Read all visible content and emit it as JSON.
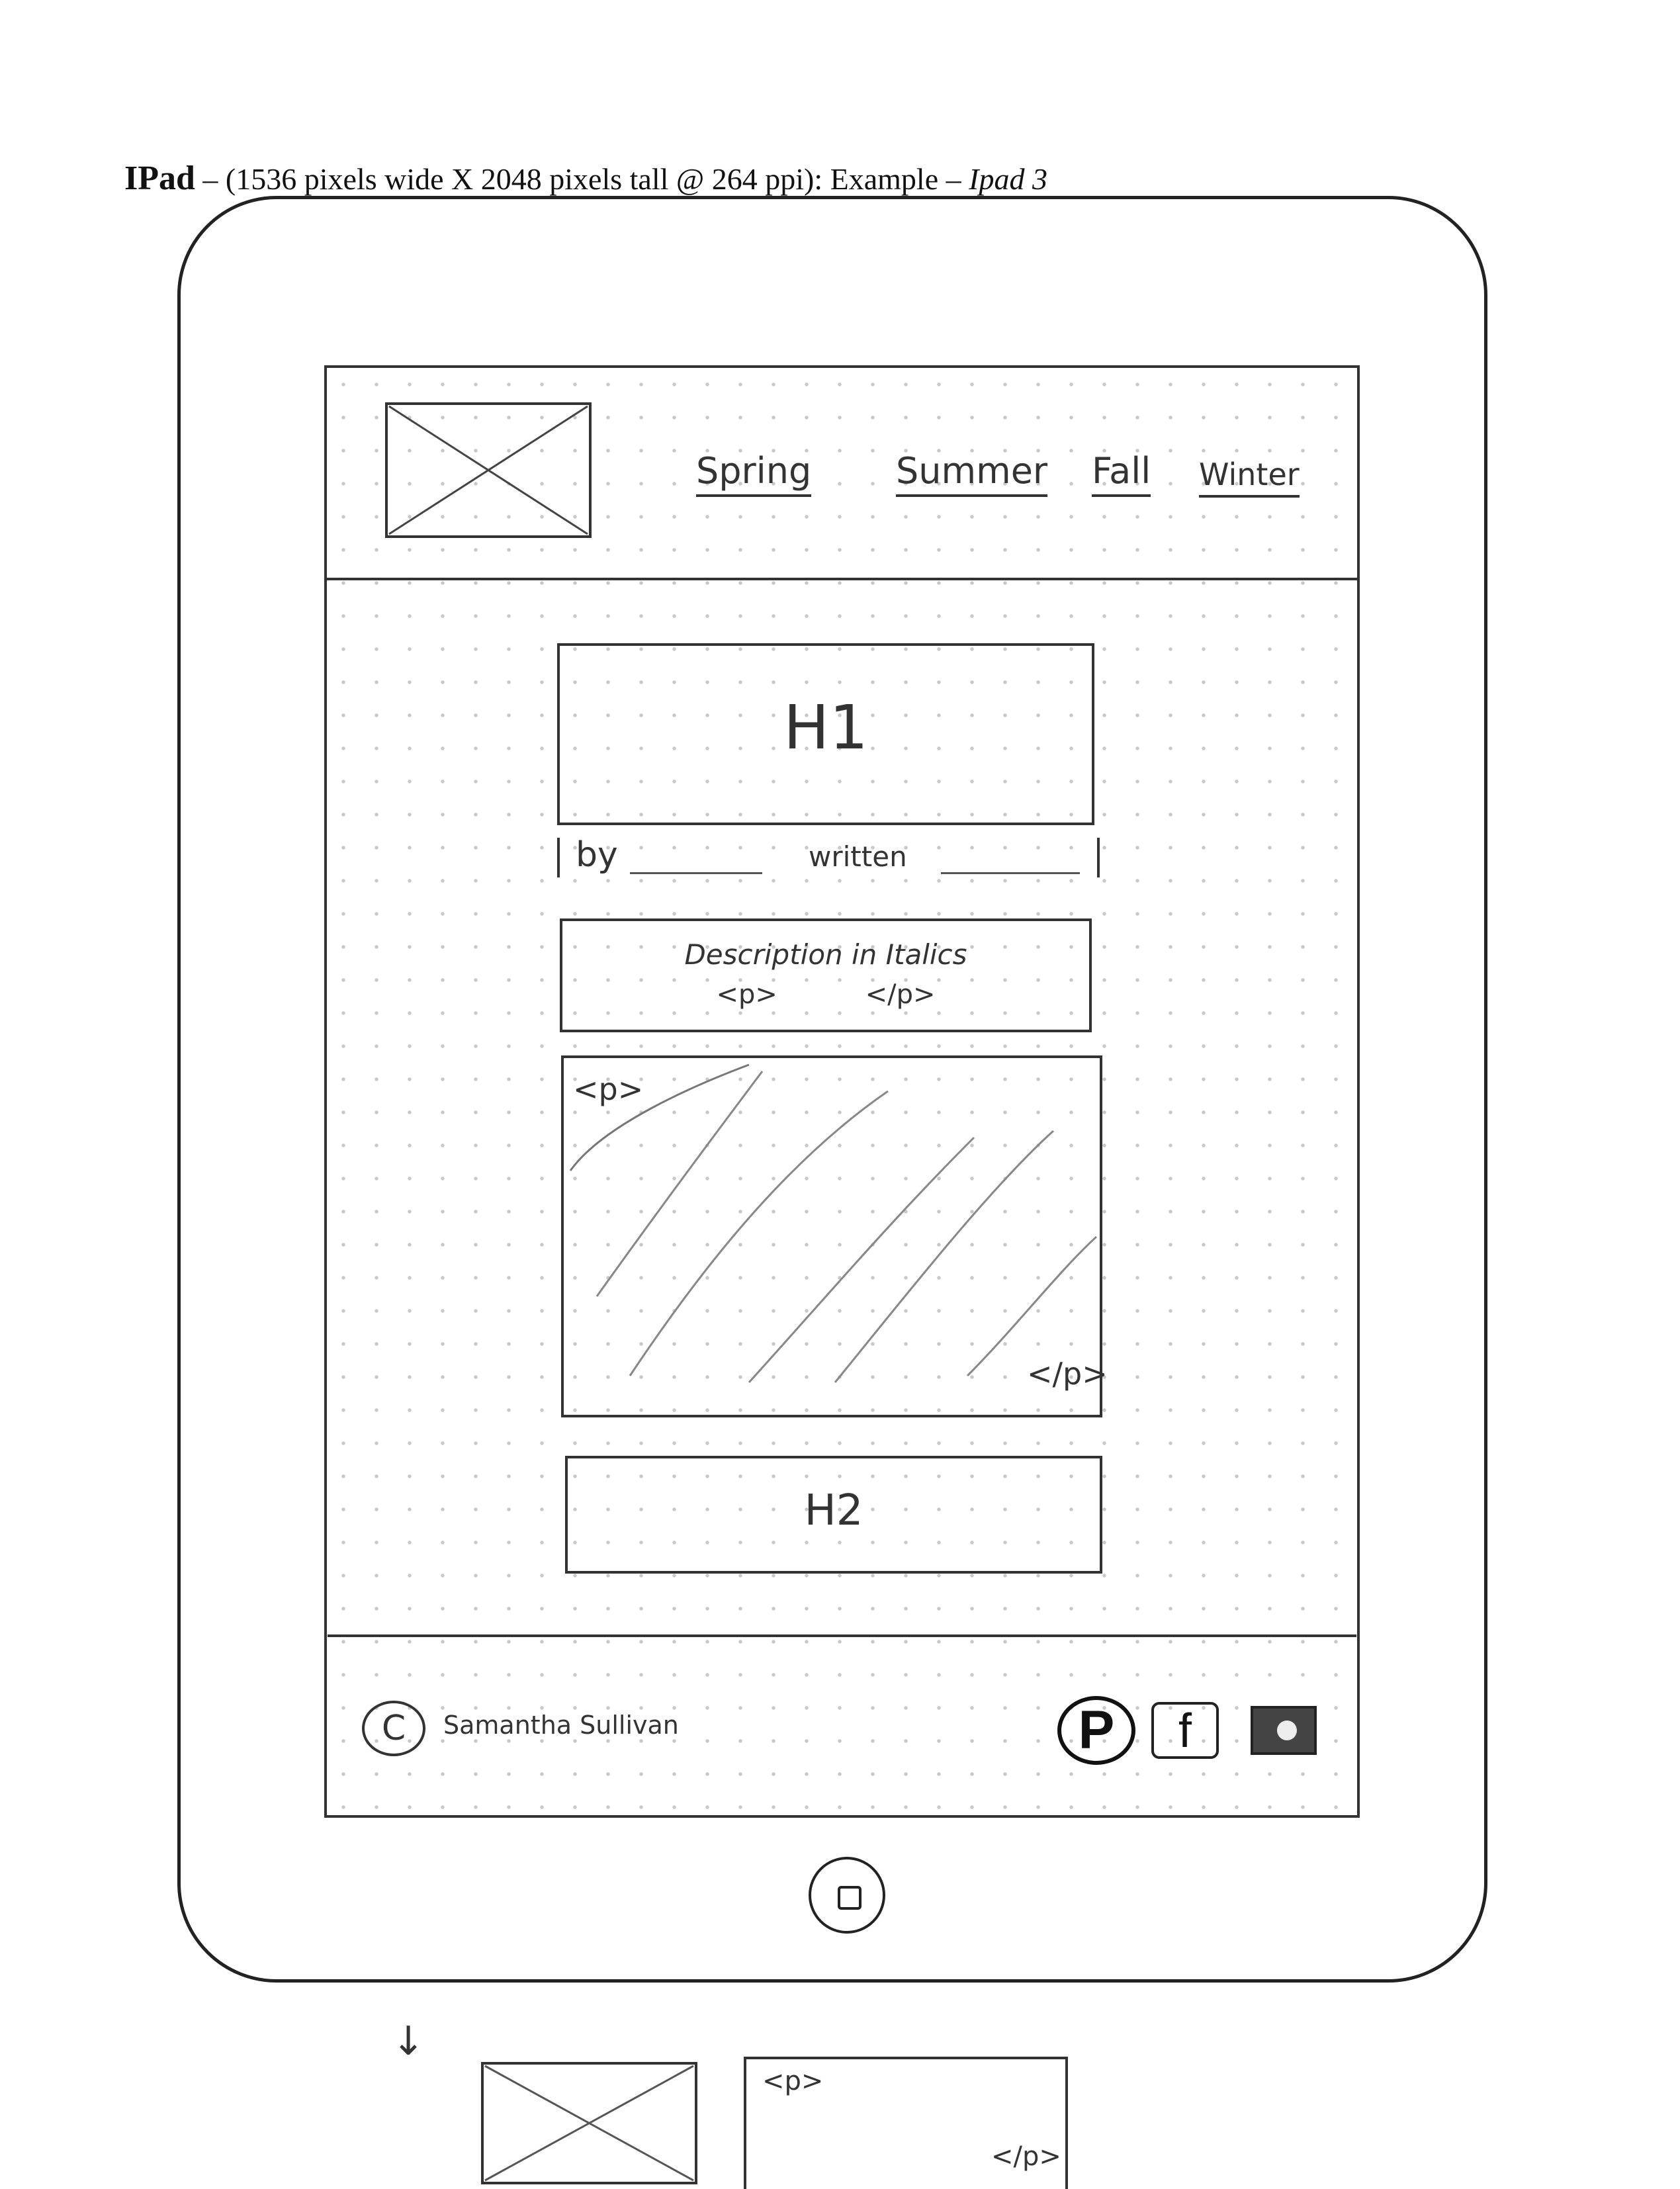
{
  "heading": {
    "device_name": "IPad",
    "spec": "– (1536 pixels wide X 2048 pixels tall @ 264 ppi): Example –",
    "example": "Ipad 3"
  },
  "nav": {
    "items": [
      {
        "label": "Spring"
      },
      {
        "label": "Summer"
      },
      {
        "label": "Fall"
      },
      {
        "label": "Winter"
      }
    ]
  },
  "content": {
    "h1": "H1",
    "by_label": "by",
    "written_label": "written",
    "description": "Description in Italics",
    "desc_tags": "<p> </p>",
    "para_open": "<p>",
    "para_close": "</p>",
    "h2": "H2"
  },
  "footer": {
    "copyright_symbol": "C",
    "author": "Samantha Sullivan",
    "social": {
      "pinterest_glyph": "P",
      "facebook_glyph": "f"
    }
  },
  "below_sketch": {
    "arrow": "↓",
    "para_open": "<p>",
    "para_close": "</p>"
  }
}
